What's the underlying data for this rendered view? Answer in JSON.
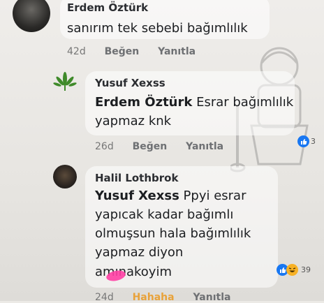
{
  "comments": [
    {
      "author": "Erdem Öztürk",
      "text": "sanırım tek sebebi bağımlılık",
      "time": "42d",
      "like_label": "Beğen",
      "reply_label": "Yanıtla"
    },
    {
      "author": "Yusuf Xexss",
      "mention": "Erdem Öztürk",
      "text_line1": "Esrar bağımlılık",
      "text_line2": "yapmaz knk",
      "time": "26d",
      "like_label": "Beğen",
      "reply_label": "Yanıtla",
      "reaction_count": "3"
    },
    {
      "author": "Halil Lothbrok",
      "mention": "Yusuf Xexss",
      "text_line1": "Ppyi esrar",
      "text_line2": "yapıcak kadar bağımlı",
      "text_line3": "olmuşsun hala bağımlılık",
      "text_line4": "yapmaz diyon",
      "text_line5": "amınakoyim",
      "time": "24d",
      "like_label": "Hahaha",
      "reply_label": "Yanıtla",
      "reaction_count": "39"
    }
  ],
  "colors": {
    "like_blue": "#1877f2",
    "haha_yellow": "#f7b125",
    "haha_label": "#e8a23a",
    "scribble_pink": "#ff3fa4"
  }
}
